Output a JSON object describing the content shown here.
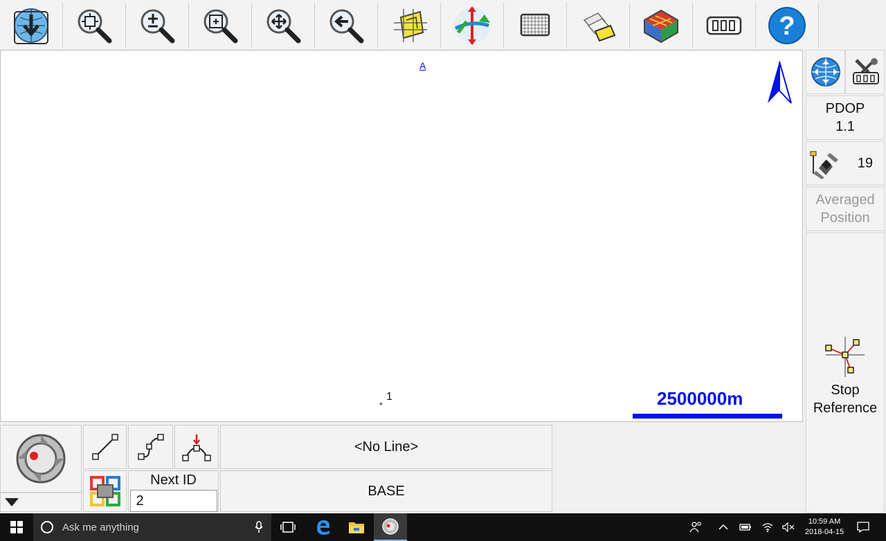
{
  "toolbar": {
    "buttons": [
      {
        "name": "load-map-button",
        "icon": "globe-download-icon"
      },
      {
        "name": "zoom-extents-button",
        "icon": "zoom-extents-icon"
      },
      {
        "name": "zoom-in-out-button",
        "icon": "zoom-plus-minus-icon"
      },
      {
        "name": "zoom-window-button",
        "icon": "zoom-window-icon"
      },
      {
        "name": "pan-button",
        "icon": "pan-magnifier-icon"
      },
      {
        "name": "zoom-previous-button",
        "icon": "zoom-back-icon"
      },
      {
        "name": "layers-button",
        "icon": "map-sheet-icon"
      },
      {
        "name": "rotate-view-button",
        "icon": "3d-axes-icon"
      },
      {
        "name": "grid-button",
        "icon": "grid-icon"
      },
      {
        "name": "overlay-button",
        "icon": "overlay-pages-icon"
      },
      {
        "name": "surface-button",
        "icon": "surface-3d-icon"
      },
      {
        "name": "settings-button",
        "icon": "slider-settings-icon"
      },
      {
        "name": "help-button",
        "icon": "help-icon"
      }
    ]
  },
  "map": {
    "north_label": "A",
    "point_label": "1",
    "scale_label": "2500000m"
  },
  "side": {
    "pdop_label": "PDOP",
    "pdop_value": "1.1",
    "satellites": "19",
    "averaged_line1": "Averaged",
    "averaged_line2": "Position",
    "stop_line1": "Stop",
    "stop_line2": "Reference"
  },
  "bottom": {
    "line_select": "<No Line>",
    "next_id_label": "Next ID",
    "next_id_value": "2",
    "mode": "BASE"
  },
  "taskbar": {
    "search_placeholder": "Ask me anything",
    "time": "10:59 AM",
    "date": "2018-04-15"
  },
  "colors": {
    "accent_blue": "#0010ee",
    "help_blue": "#1a7fd6",
    "highlight_yellow": "#f2e33a"
  }
}
